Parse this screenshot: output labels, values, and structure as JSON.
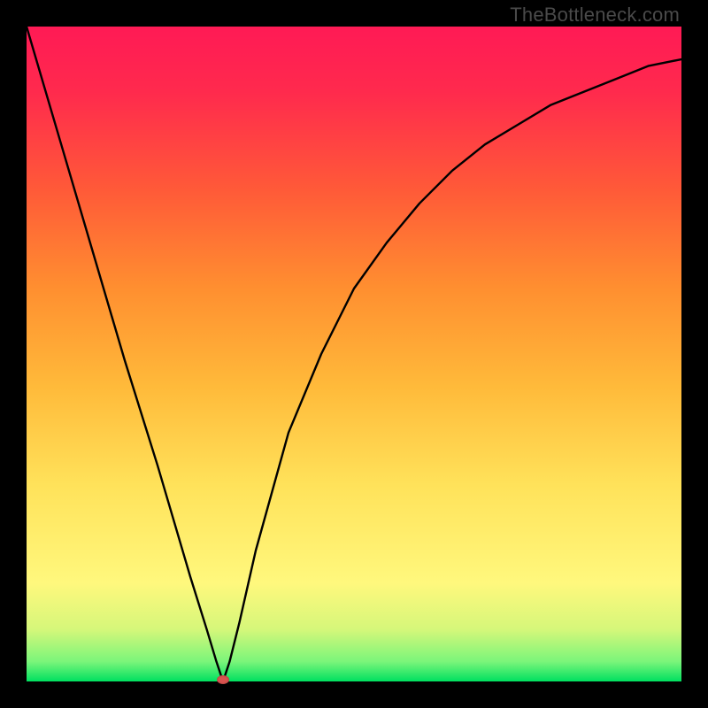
{
  "watermark": "TheBottleneck.com",
  "chart_data": {
    "type": "line",
    "title": "",
    "xlabel": "",
    "ylabel": "",
    "xlim": [
      0,
      1
    ],
    "ylim": [
      0,
      1
    ],
    "minimum_x": 0.3,
    "marker_x": 0.3,
    "marker_y": 0.0,
    "series": [
      {
        "name": "bottleneck-curve",
        "x": [
          0.0,
          0.05,
          0.1,
          0.15,
          0.2,
          0.25,
          0.275,
          0.29,
          0.3,
          0.31,
          0.325,
          0.35,
          0.4,
          0.45,
          0.5,
          0.55,
          0.6,
          0.65,
          0.7,
          0.75,
          0.8,
          0.85,
          0.9,
          0.95,
          1.0
        ],
        "y": [
          1.0,
          0.83,
          0.66,
          0.49,
          0.33,
          0.16,
          0.08,
          0.03,
          0.0,
          0.03,
          0.09,
          0.2,
          0.38,
          0.5,
          0.6,
          0.67,
          0.73,
          0.78,
          0.82,
          0.85,
          0.88,
          0.9,
          0.92,
          0.94,
          0.95
        ]
      }
    ],
    "gradient_stops": [
      {
        "y": 0.0,
        "color": "#00e060"
      },
      {
        "y": 0.03,
        "color": "#7af57a"
      },
      {
        "y": 0.08,
        "color": "#d6f77a"
      },
      {
        "y": 0.15,
        "color": "#fff87d"
      },
      {
        "y": 0.3,
        "color": "#ffe25a"
      },
      {
        "y": 0.45,
        "color": "#ffba3a"
      },
      {
        "y": 0.6,
        "color": "#ff8f30"
      },
      {
        "y": 0.75,
        "color": "#ff5a38"
      },
      {
        "y": 0.9,
        "color": "#ff2a4d"
      },
      {
        "y": 1.0,
        "color": "#ff1a55"
      }
    ]
  }
}
